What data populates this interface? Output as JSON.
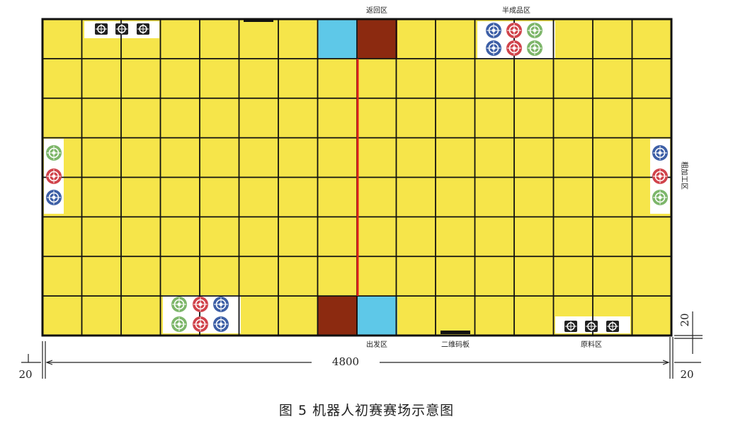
{
  "field": {
    "cols": 16,
    "rows": 8,
    "colors": {
      "field_yellow": "#f6e54a",
      "grid_line": "#111111",
      "start_blue": "#5ec8e8",
      "start_brown": "#8c2a10",
      "center_line_red": "#e0201b",
      "white_zone": "#ffffff",
      "ring_green": "#7db66a",
      "ring_red": "#d0434b",
      "ring_blue": "#3d5fa6"
    }
  },
  "labels": {
    "return_zone": "返回区",
    "semi_finished_zone": "半成品区",
    "rough_processing_zone": "粗加工区",
    "start_zone": "出发区",
    "qr_code_board": "二维码板",
    "raw_material_zone": "原料区"
  },
  "dimensions": {
    "width": "4800",
    "margin_left": "20",
    "margin_right": "20",
    "margin_side": "20"
  },
  "caption": "图 5 机器人初赛赛场示意图"
}
